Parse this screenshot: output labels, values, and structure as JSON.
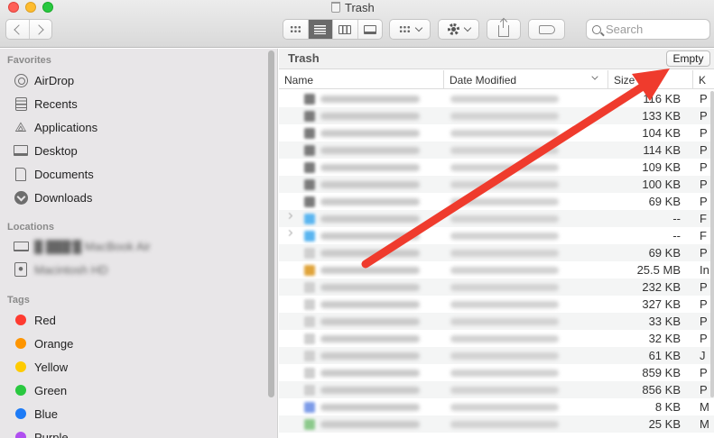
{
  "window": {
    "title": "Trash"
  },
  "toolbar": {
    "search_placeholder": "Search",
    "view_modes": [
      "icon-view",
      "list-view",
      "column-view",
      "gallery-view"
    ],
    "active_view": "list-view"
  },
  "sidebar": {
    "favorites_heading": "Favorites",
    "favorites": [
      {
        "label": "AirDrop",
        "icon": "airdrop-icon"
      },
      {
        "label": "Recents",
        "icon": "recents-icon"
      },
      {
        "label": "Applications",
        "icon": "applications-icon"
      },
      {
        "label": "Desktop",
        "icon": "desktop-icon"
      },
      {
        "label": "Documents",
        "icon": "documents-icon"
      },
      {
        "label": "Downloads",
        "icon": "downloads-icon"
      }
    ],
    "locations_heading": "Locations",
    "locations": [
      {
        "label": "█ ███'█ MacBook Air",
        "icon": "laptop-icon"
      },
      {
        "label": "Macintosh HD",
        "icon": "disk-icon"
      }
    ],
    "tags_heading": "Tags",
    "tags": [
      {
        "label": "Red",
        "color": "#fe3b30"
      },
      {
        "label": "Orange",
        "color": "#fe9500"
      },
      {
        "label": "Yellow",
        "color": "#fecb00"
      },
      {
        "label": "Green",
        "color": "#2ac840"
      },
      {
        "label": "Blue",
        "color": "#1e7bf6"
      },
      {
        "label": "Purple",
        "color": "#b04ff0"
      }
    ]
  },
  "main": {
    "path_title": "Trash",
    "empty_button": "Empty",
    "columns": {
      "name": "Name",
      "date": "Date Modified",
      "size": "Size",
      "kind": "K"
    },
    "rows": [
      {
        "size": "116 KB",
        "kind": "P",
        "icon_color": "#7a7a7a",
        "folder": false
      },
      {
        "size": "133 KB",
        "kind": "P",
        "icon_color": "#7a7a7a",
        "folder": false
      },
      {
        "size": "104 KB",
        "kind": "P",
        "icon_color": "#7a7a7a",
        "folder": false
      },
      {
        "size": "114 KB",
        "kind": "P",
        "icon_color": "#7a7a7a",
        "folder": false
      },
      {
        "size": "109 KB",
        "kind": "P",
        "icon_color": "#7a7a7a",
        "folder": false
      },
      {
        "size": "100 KB",
        "kind": "P",
        "icon_color": "#7a7a7a",
        "folder": false
      },
      {
        "size": "69 KB",
        "kind": "P",
        "icon_color": "#7a7a7a",
        "folder": false
      },
      {
        "size": "--",
        "kind": "F",
        "icon_color": "#5ab5f0",
        "folder": true
      },
      {
        "size": "--",
        "kind": "F",
        "icon_color": "#5ab5f0",
        "folder": true
      },
      {
        "size": "69 KB",
        "kind": "P",
        "icon_color": "#cfcfcf",
        "folder": false
      },
      {
        "size": "25.5 MB",
        "kind": "In",
        "icon_color": "#e0a43a",
        "folder": false
      },
      {
        "size": "232 KB",
        "kind": "P",
        "icon_color": "#cfcfcf",
        "folder": false
      },
      {
        "size": "327 KB",
        "kind": "P",
        "icon_color": "#cfcfcf",
        "folder": false
      },
      {
        "size": "33 KB",
        "kind": "P",
        "icon_color": "#cfcfcf",
        "folder": false
      },
      {
        "size": "32 KB",
        "kind": "P",
        "icon_color": "#cfcfcf",
        "folder": false
      },
      {
        "size": "61 KB",
        "kind": "J",
        "icon_color": "#cfcfcf",
        "folder": false
      },
      {
        "size": "859 KB",
        "kind": "P",
        "icon_color": "#cfcfcf",
        "folder": false
      },
      {
        "size": "856 KB",
        "kind": "P",
        "icon_color": "#cfcfcf",
        "folder": false
      },
      {
        "size": "8 KB",
        "kind": "M",
        "icon_color": "#7c9be8",
        "folder": false
      },
      {
        "size": "25 KB",
        "kind": "M",
        "icon_color": "#8cc98c",
        "folder": false
      }
    ]
  },
  "annotation": {
    "arrow_color": "#ef3b2d"
  }
}
